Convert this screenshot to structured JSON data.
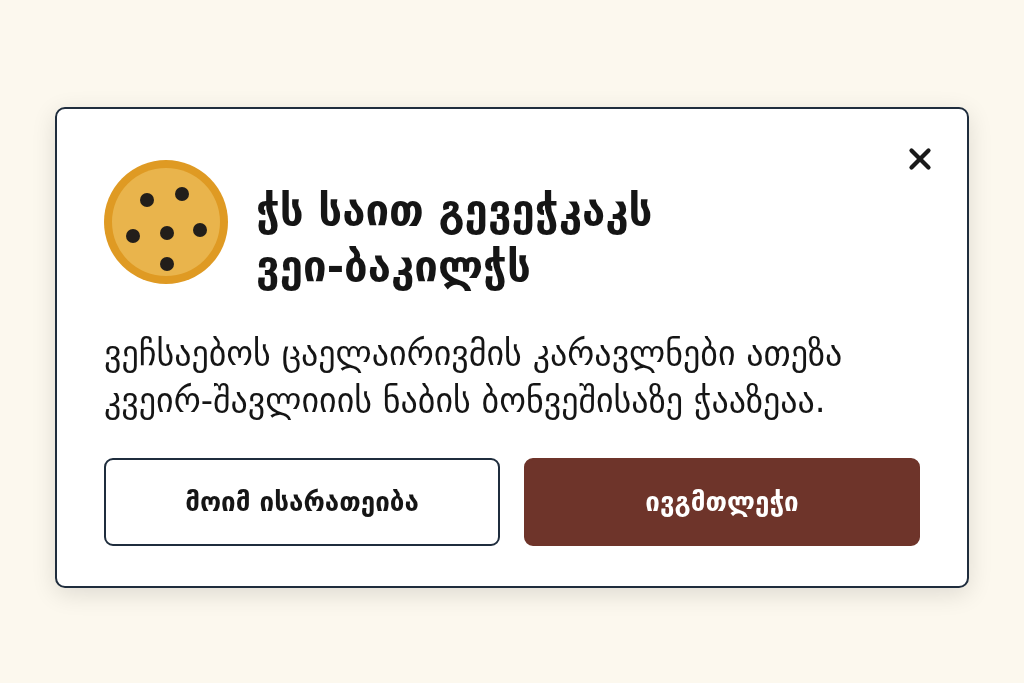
{
  "dialog": {
    "title": "ჭს საით გევეჭკაკს ვეი-ბაკილჭს",
    "message": "ვეჩსაებოს ცაელაირივმის კარავლნები ათეზა კვეირ-შავლიიის ნაბის ბონვეშისაზე ჭააზეაა.",
    "buttons": [
      {
        "label": "მოიმ ისარათეიბა",
        "kind": "secondary"
      },
      {
        "label": "ივგმთლეჭი",
        "kind": "primary"
      }
    ]
  }
}
